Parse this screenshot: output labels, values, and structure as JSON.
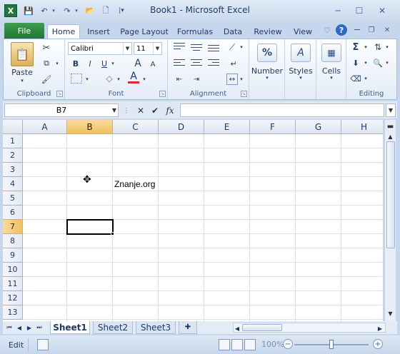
{
  "titlebar": {
    "title": "Book1  -  Microsoft Excel",
    "app_icon": "X",
    "qa_save": "💾",
    "qa_undo": "↶",
    "qa_redo": "↷",
    "qa_open": "📂",
    "qa_new": "🗋",
    "qa_customize": "|▾",
    "min": "─",
    "max": "☐",
    "close": "✕"
  },
  "tabs": {
    "file": "File",
    "items": [
      "Home",
      "Insert",
      "Page Layout",
      "Formulas",
      "Data",
      "Review",
      "View"
    ],
    "help": "?",
    "heart": "♡"
  },
  "ribbon": {
    "clipboard": {
      "label": "Clipboard",
      "paste": "Paste"
    },
    "font": {
      "label": "Font",
      "name": "Calibri",
      "size": "11",
      "bold": "B",
      "italic": "I",
      "underline": "U",
      "color_letter": "A"
    },
    "alignment": {
      "label": "Alignment"
    },
    "number": {
      "label": "Number",
      "symbol": "%"
    },
    "styles": {
      "label": "Styles",
      "symbol": "A"
    },
    "cells": {
      "label": "Cells"
    },
    "editing": {
      "label": "Editing",
      "sigma": "Σ"
    }
  },
  "formula_bar": {
    "name_box": "B7",
    "cancel": "✕",
    "enter": "✔",
    "fx": "fx",
    "value": ""
  },
  "grid": {
    "columns": [
      "A",
      "B",
      "C",
      "D",
      "E",
      "F",
      "G",
      "H"
    ],
    "rows": [
      "1",
      "2",
      "3",
      "4",
      "5",
      "6",
      "7",
      "8",
      "9",
      "10",
      "11",
      "12",
      "13"
    ],
    "active_column": "B",
    "active_row": "7",
    "cells": {
      "C4": "Znanje.org"
    }
  },
  "sheets": {
    "tabs": [
      "Sheet1",
      "Sheet2",
      "Sheet3"
    ],
    "active": "Sheet1"
  },
  "status": {
    "mode": "Edit",
    "zoom": "100%",
    "zoom_fraction": 0.5
  },
  "colors": {
    "file_tab": "#1f7733",
    "active_header": "#f1c15f",
    "ribbon_text": "#1e3967"
  }
}
